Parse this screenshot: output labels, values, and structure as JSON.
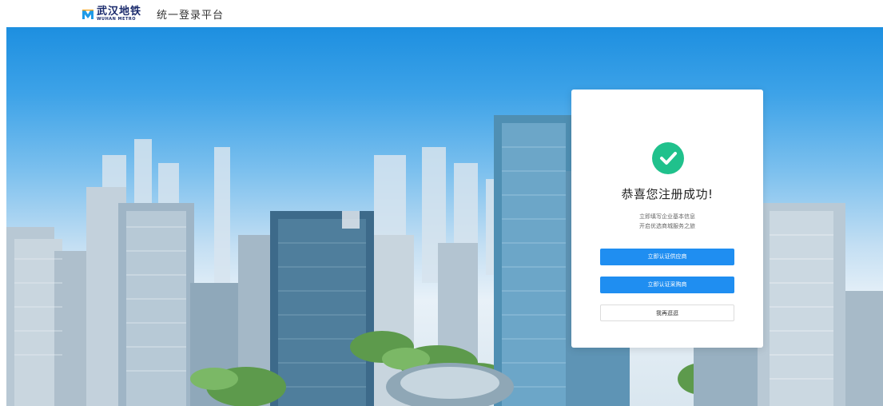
{
  "header": {
    "logo_cn": "武汉地铁",
    "logo_en": "WUHAN METRO",
    "platform_title": "统一登录平台"
  },
  "card": {
    "title": "恭喜您注册成功!",
    "subtitle_line1": "立即填写企业基本信息",
    "subtitle_line2": "开启优选商城服务之旅",
    "buttons": {
      "supplier": "立即认证供应商",
      "purchaser": "立即认证采购商",
      "later": "我再逛逛"
    }
  },
  "colors": {
    "primary": "#1f8ef1",
    "success": "#20c18c",
    "brand": "#1a2a6c"
  }
}
